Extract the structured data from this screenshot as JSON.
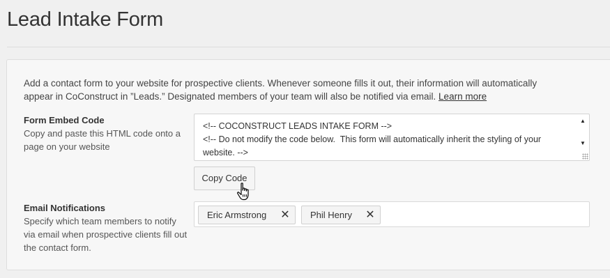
{
  "page": {
    "title": "Lead Intake Form"
  },
  "intro": {
    "text": "Add a contact form to your website for prospective clients. Whenever someone fills it out, their information will automatically appear in CoConstruct in ”Leads.” Designated members of your team will also be notified via email. ",
    "link": "Learn more"
  },
  "embed": {
    "label": "Form Embed Code",
    "description": "Copy and paste this HTML code onto a page on your website",
    "code": "<!-- COCONSTRUCT LEADS INTAKE FORM -->\n<!-- Do not modify the code below.  This form will automatically inherit the styling of your website. -->",
    "copy_label": "Copy Code"
  },
  "notifications": {
    "label": "Email Notifications",
    "description": "Specify which team members to notify via email when prospective clients fill out the contact form.",
    "tags": [
      {
        "name": "Eric Armstrong",
        "remove_icon": "close-icon"
      },
      {
        "name": "Phil Henry",
        "remove_icon": "close-icon"
      }
    ]
  },
  "icons": {
    "scroll_up": "chevron-up-icon",
    "scroll_down": "chevron-down-icon",
    "cursor": "hand-pointer-icon"
  }
}
